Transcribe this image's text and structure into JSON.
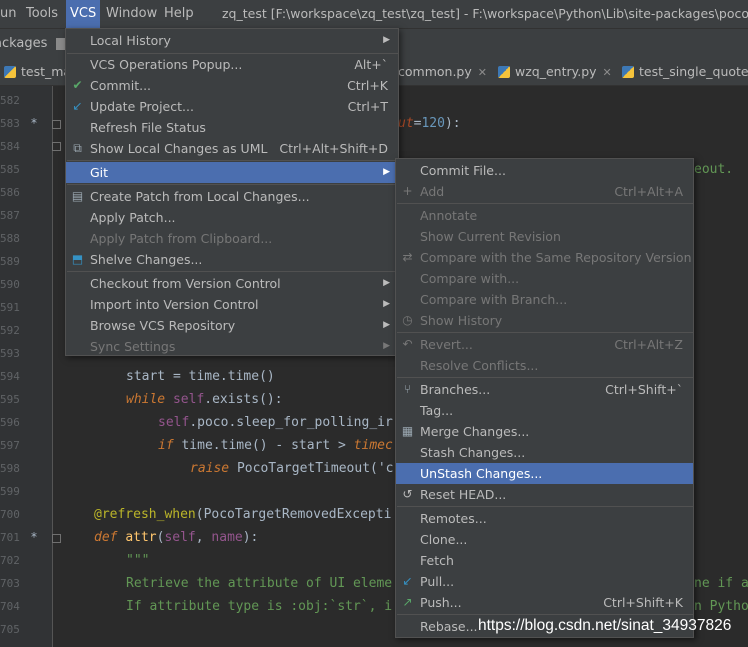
{
  "menubar": {
    "items": [
      "un",
      "Tools",
      "VCS",
      "Window",
      "Help"
    ],
    "window_title": "zq_test [F:\\workspace\\zq_test\\zq_test] - F:\\workspace\\Python\\Lib\\site-packages\\poco\\prox"
  },
  "navbar": {
    "crumb": "ackages"
  },
  "tabs": [
    {
      "label": "test_ma"
    },
    {
      "label": "common.py"
    },
    {
      "label": "wzq_entry.py"
    },
    {
      "label": "test_single_quote.p"
    }
  ],
  "editor": {
    "line_numbers": [
      "582",
      "583",
      "584",
      "585",
      "586",
      "587",
      "588",
      "589",
      "590",
      "591",
      "592",
      "593",
      "594",
      "595",
      "596",
      "597",
      "598",
      "599",
      "700",
      "701",
      "702",
      "703",
      "704",
      "705"
    ],
    "code_fragments": {
      "l583": "ut",
      "l583_eq": "=",
      "l583_num": "120",
      "l583_end": "):",
      "l585": "eout.",
      "l594_a": "start = time.",
      "l594_fn": "time",
      "l594_b": "()",
      "l595_kw": "while ",
      "l595_self": "self",
      "l595_b": ".exists():",
      "l596_self": "self",
      "l596_b": ".poco.",
      "l596_fn": "sleep_for_polling_ir",
      "l597_kw": "if ",
      "l597_a": "time.",
      "l597_fn": "time",
      "l597_b": "() - start > ",
      "l597_c": "timec",
      "l598_kw": "raise ",
      "l598_a": "PocoTargetTimeout('c",
      "l700_dec": "@refresh_when",
      "l700_a": "(PocoTargetRemovedExcepti",
      "l701_kw": "def ",
      "l701_fn": "attr",
      "l701_a": "(",
      "l701_self": "self",
      "l701_b": ", ",
      "l701_name": "name",
      "l701_c": "):",
      "l702": "\"\"\"",
      "l703_a": "Retrieve the attribute of UI eleme",
      "l703_b": "ne if a",
      "l704_a": "If attribute type is :obj:`str`, i",
      "l704_b": "n Pytho"
    }
  },
  "vcs_menu": {
    "items": [
      {
        "label": "Local History",
        "shortcut": "",
        "submenu": true
      },
      {
        "label": "VCS Operations Popup...",
        "shortcut": "Alt+`"
      },
      {
        "label": "Commit...",
        "shortcut": "Ctrl+K",
        "icon": "check-icon"
      },
      {
        "label": "Update Project...",
        "shortcut": "Ctrl+T",
        "icon": "update-arrow-icon"
      },
      {
        "label": "Refresh File Status",
        "shortcut": ""
      },
      {
        "label": "Show Local Changes as UML",
        "shortcut": "Ctrl+Alt+Shift+D",
        "icon": "uml-icon"
      },
      {
        "label": "Git",
        "shortcut": "",
        "submenu": true
      },
      {
        "label": "Create Patch from Local Changes...",
        "shortcut": "",
        "icon": "patch-icon"
      },
      {
        "label": "Apply Patch...",
        "shortcut": ""
      },
      {
        "label": "Apply Patch from Clipboard...",
        "shortcut": ""
      },
      {
        "label": "Shelve Changes...",
        "shortcut": "",
        "icon": "shelve-icon"
      },
      {
        "label": "Checkout from Version Control",
        "shortcut": "",
        "submenu": true
      },
      {
        "label": "Import into Version Control",
        "shortcut": "",
        "submenu": true
      },
      {
        "label": "Browse VCS Repository",
        "shortcut": "",
        "submenu": true
      },
      {
        "label": "Sync Settings",
        "shortcut": "",
        "submenu": true
      }
    ]
  },
  "git_menu": {
    "items": [
      {
        "label": "Commit File...",
        "shortcut": ""
      },
      {
        "label": "Add",
        "shortcut": "Ctrl+Alt+A"
      },
      {
        "label": "Annotate",
        "shortcut": ""
      },
      {
        "label": "Show Current Revision",
        "shortcut": ""
      },
      {
        "label": "Compare with the Same Repository Version",
        "shortcut": ""
      },
      {
        "label": "Compare with...",
        "shortcut": ""
      },
      {
        "label": "Compare with Branch...",
        "shortcut": ""
      },
      {
        "label": "Show History",
        "shortcut": ""
      },
      {
        "label": "Revert...",
        "shortcut": "Ctrl+Alt+Z"
      },
      {
        "label": "Resolve Conflicts...",
        "shortcut": ""
      },
      {
        "label": "Branches...",
        "shortcut": "Ctrl+Shift+`"
      },
      {
        "label": "Tag...",
        "shortcut": ""
      },
      {
        "label": "Merge Changes...",
        "shortcut": ""
      },
      {
        "label": "Stash Changes...",
        "shortcut": ""
      },
      {
        "label": "UnStash Changes...",
        "shortcut": ""
      },
      {
        "label": "Reset HEAD...",
        "shortcut": ""
      },
      {
        "label": "Remotes...",
        "shortcut": ""
      },
      {
        "label": "Clone...",
        "shortcut": ""
      },
      {
        "label": "Fetch",
        "shortcut": ""
      },
      {
        "label": "Pull...",
        "shortcut": ""
      },
      {
        "label": "Push...",
        "shortcut": "Ctrl+Shift+K"
      },
      {
        "label": "Rebase...",
        "shortcut": ""
      }
    ]
  },
  "watermark": "https://blog.csdn.net/sinat_34937826",
  "colors": {
    "accent": "#4b6eaf",
    "menu_bg": "#3c3f41",
    "editor_bg": "#2b2b2b"
  }
}
